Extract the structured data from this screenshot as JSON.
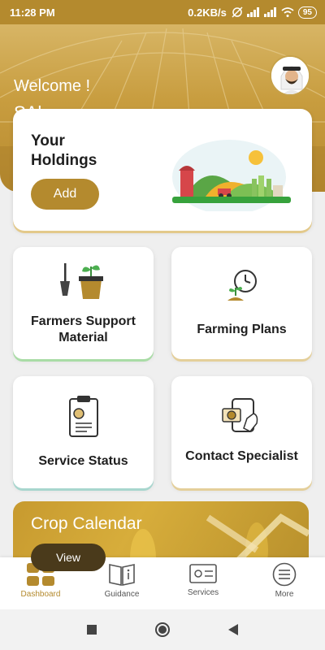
{
  "status_bar": {
    "time": "11:28 PM",
    "network_speed": "0.2KB/s",
    "battery": "95"
  },
  "header": {
    "welcome": "Welcome !",
    "username": "SAhmseer"
  },
  "holdings": {
    "title": "Your Holdings",
    "add_label": "Add"
  },
  "tiles": [
    {
      "label": "Farmers Support Material",
      "icon": "plant-pot-shovel-icon"
    },
    {
      "label": "Farming Plans",
      "icon": "plant-clock-icon"
    },
    {
      "label": "Service Status",
      "icon": "clipboard-icon"
    },
    {
      "label": "Contact Specialist",
      "icon": "phone-camera-icon"
    }
  ],
  "crop_calendar": {
    "title": "Crop Calendar",
    "view_label": "View"
  },
  "bottom_nav": [
    {
      "label": "Dashboard",
      "icon": "dashboard-grid-icon",
      "active": true
    },
    {
      "label": "Guidance",
      "icon": "book-info-icon",
      "active": false
    },
    {
      "label": "Services",
      "icon": "services-card-icon",
      "active": false
    },
    {
      "label": "More",
      "icon": "menu-icon",
      "active": false
    }
  ],
  "colors": {
    "accent": "#b48a2e",
    "text": "#1f1f1f"
  }
}
